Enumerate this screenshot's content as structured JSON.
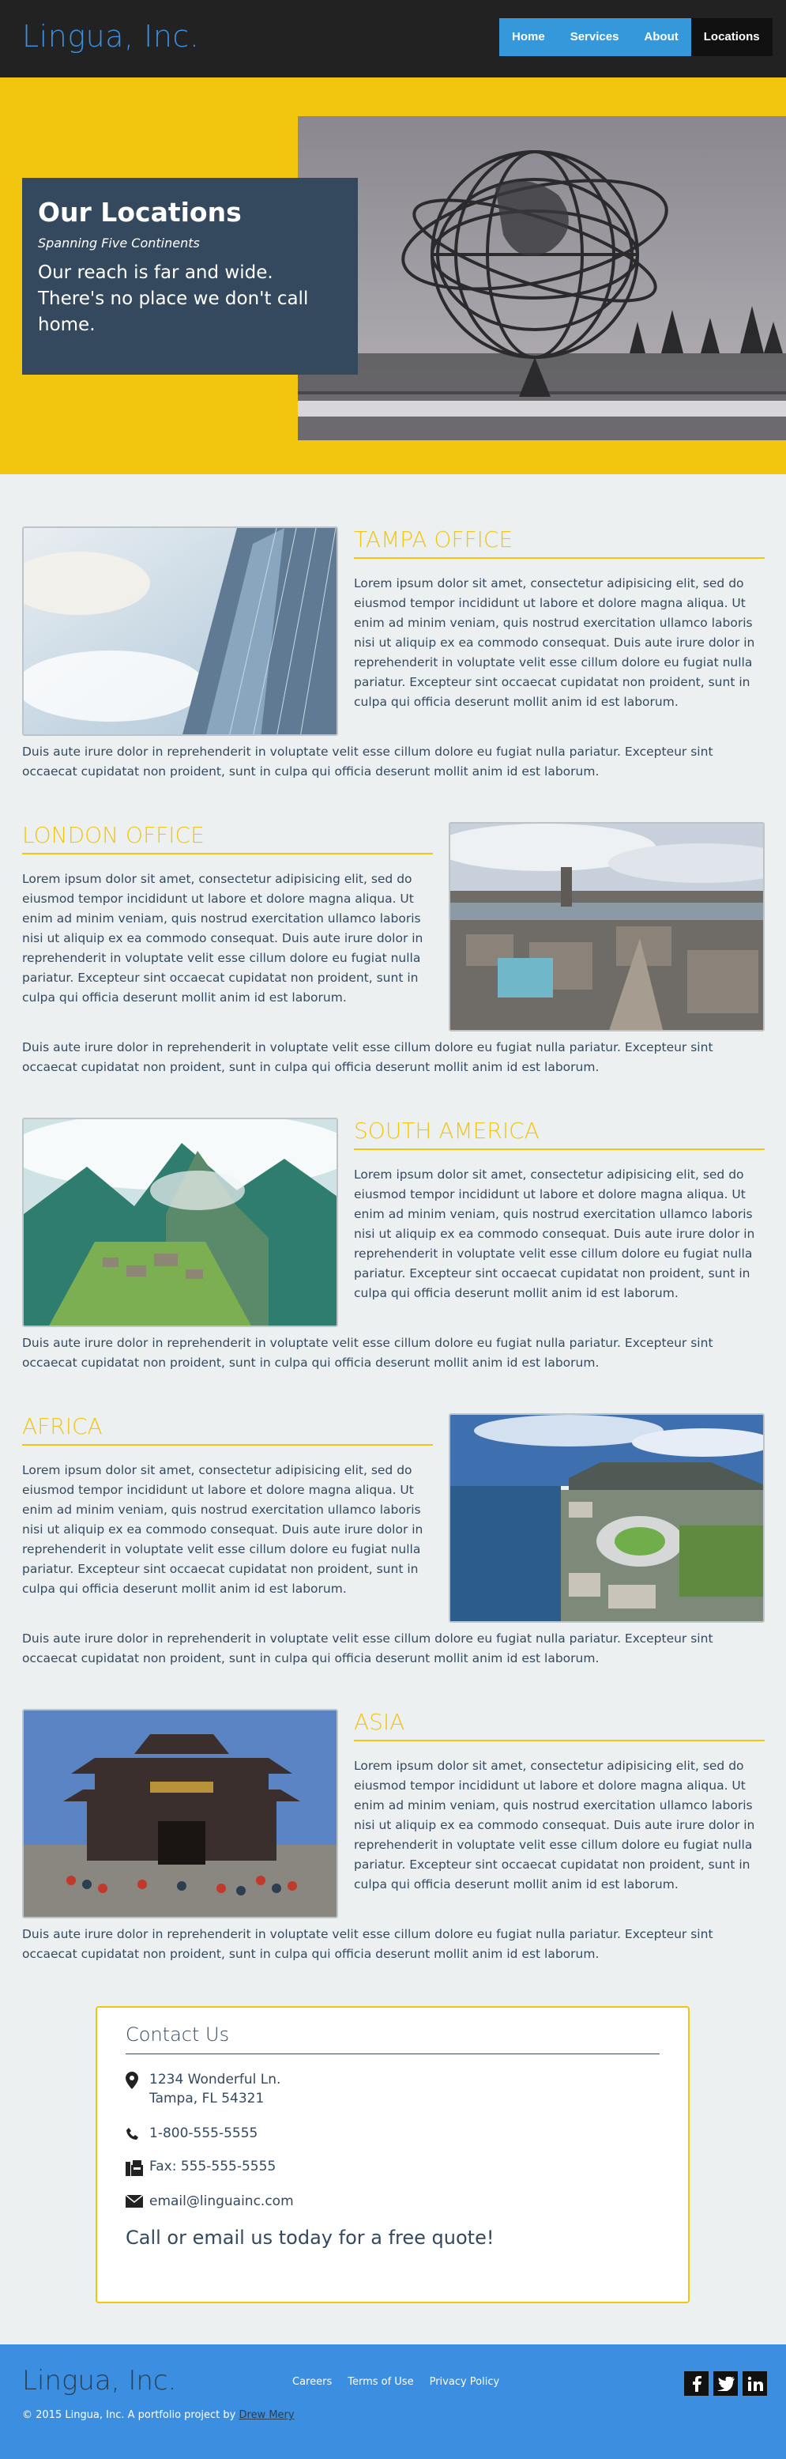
{
  "header": {
    "logo": "Lingua, Inc.",
    "nav": [
      {
        "label": "Home"
      },
      {
        "label": "Services"
      },
      {
        "label": "About"
      },
      {
        "label": "Locations",
        "active": true
      }
    ]
  },
  "hero": {
    "title": "Our Locations",
    "subtitle": "Spanning Five Continents",
    "tagline": "Our reach is far and wide. There's no place we don't call home."
  },
  "offices": [
    {
      "title": "TAMPA OFFICE",
      "para": "Lorem ipsum dolor sit amet, consectetur adipisicing elit, sed do eiusmod tempor incididunt ut labore et dolore magna aliqua. Ut enim ad minim veniam, quis nostrud exercitation ullamco laboris nisi ut aliquip ex ea commodo consequat. Duis aute irure dolor in reprehenderit in voluptate velit esse cillum dolore eu fugiat nulla pariatur. Excepteur sint occaecat cupidatat non proident, sunt in culpa qui officia deserunt mollit anim id est laborum.",
      "more": "Duis aute irure dolor in reprehenderit in voluptate velit esse cillum dolore eu fugiat nulla pariatur. Excepteur sint occaecat cupidatat non proident, sunt in culpa qui officia deserunt mollit anim id est laborum."
    },
    {
      "title": "LONDON OFFICE",
      "para": "Lorem ipsum dolor sit amet, consectetur adipisicing elit, sed do eiusmod tempor incididunt ut labore et dolore magna aliqua. Ut enim ad minim veniam, quis nostrud exercitation ullamco laboris nisi ut aliquip ex ea commodo consequat. Duis aute irure dolor in reprehenderit in voluptate velit esse cillum dolore eu fugiat nulla pariatur. Excepteur sint occaecat cupidatat non proident, sunt in culpa qui officia deserunt mollit anim id est laborum.",
      "more": "Duis aute irure dolor in reprehenderit in voluptate velit esse cillum dolore eu fugiat nulla pariatur. Excepteur sint occaecat cupidatat non proident, sunt in culpa qui officia deserunt mollit anim id est laborum."
    },
    {
      "title": "SOUTH AMERICA",
      "para": "Lorem ipsum dolor sit amet, consectetur adipisicing elit, sed do eiusmod tempor incididunt ut labore et dolore magna aliqua. Ut enim ad minim veniam, quis nostrud exercitation ullamco laboris nisi ut aliquip ex ea commodo consequat. Duis aute irure dolor in reprehenderit in voluptate velit esse cillum dolore eu fugiat nulla pariatur. Excepteur sint occaecat cupidatat non proident, sunt in culpa qui officia deserunt mollit anim id est laborum.",
      "more": "Duis aute irure dolor in reprehenderit in voluptate velit esse cillum dolore eu fugiat nulla pariatur. Excepteur sint occaecat cupidatat non proident, sunt in culpa qui officia deserunt mollit anim id est laborum."
    },
    {
      "title": "AFRICA",
      "para": "Lorem ipsum dolor sit amet, consectetur adipisicing elit, sed do eiusmod tempor incididunt ut labore et dolore magna aliqua. Ut enim ad minim veniam, quis nostrud exercitation ullamco laboris nisi ut aliquip ex ea commodo consequat. Duis aute irure dolor in reprehenderit in voluptate velit esse cillum dolore eu fugiat nulla pariatur. Excepteur sint occaecat cupidatat non proident, sunt in culpa qui officia deserunt mollit anim id est laborum.",
      "more": "Duis aute irure dolor in reprehenderit in voluptate velit esse cillum dolore eu fugiat nulla pariatur. Excepteur sint occaecat cupidatat non proident, sunt in culpa qui officia deserunt mollit anim id est laborum."
    },
    {
      "title": "ASIA",
      "para": "Lorem ipsum dolor sit amet, consectetur adipisicing elit, sed do eiusmod tempor incididunt ut labore et dolore magna aliqua. Ut enim ad minim veniam, quis nostrud exercitation ullamco laboris nisi ut aliquip ex ea commodo consequat. Duis aute irure dolor in reprehenderit in voluptate velit esse cillum dolore eu fugiat nulla pariatur. Excepteur sint occaecat cupidatat non proident, sunt in culpa qui officia deserunt mollit anim id est laborum.",
      "more": "Duis aute irure dolor in reprehenderit in voluptate velit esse cillum dolore eu fugiat nulla pariatur. Excepteur sint occaecat cupidatat non proident, sunt in culpa qui officia deserunt mollit anim id est laborum."
    }
  ],
  "contact": {
    "title": "Contact Us",
    "address_line1": "1234 Wonderful Ln.",
    "address_line2": "Tampa, FL 54321",
    "phone": "1-800-555-5555",
    "fax": "Fax: 555-555-5555",
    "email": "email@linguainc.com",
    "cta": "Call or email us today for a free quote!",
    "icons": [
      "map-marker-icon",
      "phone-icon",
      "fax-icon",
      "envelope-icon"
    ]
  },
  "footer": {
    "logo": "Lingua, Inc.",
    "links": [
      "Careers",
      "Terms of Use",
      "Privacy Policy"
    ],
    "copyright": "© 2015 Lingua, Inc.   A portfolio project by ",
    "author": "Drew Mery",
    "social_icons": [
      "facebook-icon",
      "twitter-icon",
      "linkedin-icon"
    ]
  },
  "colors": {
    "brand_blue": "#3b8ee0",
    "nav_blue": "#3498db",
    "accent_yellow": "#f2c50f",
    "dark_slate": "#34495e",
    "header_bg": "#222222",
    "page_bg": "#ecf0f1"
  }
}
